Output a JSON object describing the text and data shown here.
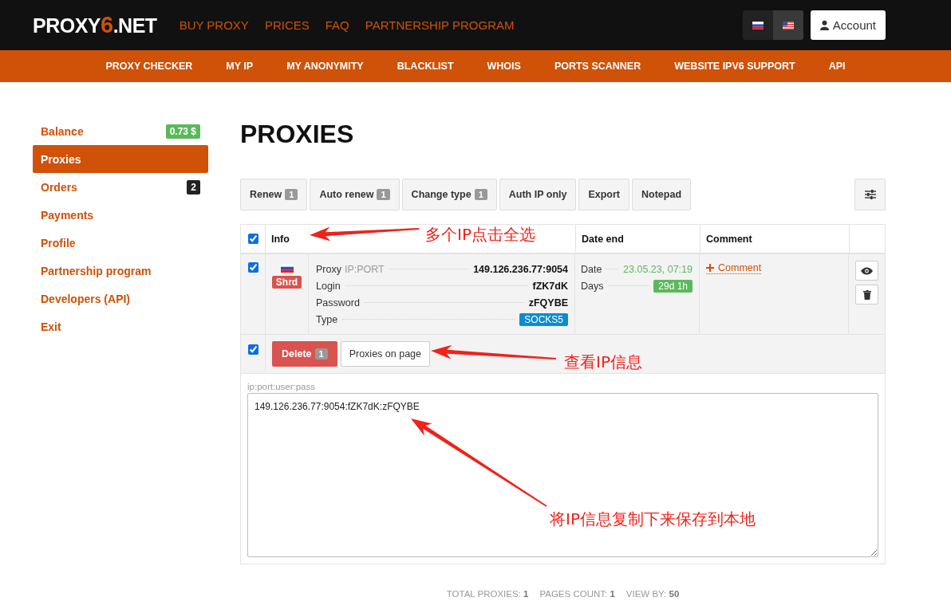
{
  "header": {
    "logo": {
      "main": "PROXY",
      "accent": "6",
      "tail": ".NET"
    },
    "menu": [
      "BUY PROXY",
      "PRICES",
      "FAQ",
      "PARTNERSHIP PROGRAM"
    ],
    "languages": [
      {
        "kind": "ru",
        "selected": false
      },
      {
        "kind": "us",
        "selected": true
      }
    ],
    "account": "Account"
  },
  "subnav": [
    "PROXY CHECKER",
    "MY IP",
    "MY ANONYMITY",
    "BLACKLIST",
    "WHOIS",
    "PORTS SCANNER",
    "WEBSITE IPV6 SUPPORT",
    "API"
  ],
  "sidebar": {
    "items": [
      {
        "label": "Balance",
        "selected": false,
        "badge": "0.73 $",
        "color": "#5cb85c"
      },
      {
        "label": "Proxies",
        "selected": true
      },
      {
        "label": "Orders",
        "selected": false,
        "badge": "2",
        "color": "#222222"
      },
      {
        "label": "Payments",
        "selected": false
      },
      {
        "label": "Profile",
        "selected": false
      },
      {
        "label": "Partnership program",
        "selected": false
      },
      {
        "label": "Developers (API)",
        "selected": false
      },
      {
        "label": "Exit",
        "selected": false
      }
    ]
  },
  "page_title": "PROXIES",
  "toolbar": [
    {
      "label": "Renew",
      "count": "1"
    },
    {
      "label": "Auto renew",
      "count": "1"
    },
    {
      "label": "Change type",
      "count": "1"
    },
    {
      "label": "Auth IP only"
    },
    {
      "label": "Export"
    },
    {
      "label": "Notepad"
    }
  ],
  "table": {
    "select_all": {
      "checked": true
    },
    "columns": [
      "Info",
      "Date end",
      "Comment"
    ],
    "rows": [
      {
        "checked": true,
        "kind": "ru",
        "tag": "Shrd",
        "info": [
          {
            "label": "Proxy",
            "hint": "IP:PORT",
            "kind": "text",
            "value": "149.126.236.77:9054"
          },
          {
            "label": "Login",
            "kind": "text",
            "value": "fZK7dK"
          },
          {
            "label": "Password",
            "kind": "text",
            "value": "zFQYBE"
          },
          {
            "label": "Type",
            "kind": "tag",
            "value": "SOCKS5",
            "color": "#0b8bd0"
          }
        ],
        "date_end": [
          {
            "label": "Date",
            "kind": "date",
            "value": "23.05.23, 07:19"
          },
          {
            "label": "Days",
            "kind": "tag",
            "value": "29d 1h",
            "color": "#5cb85c"
          }
        ],
        "comment_link": "Comment"
      }
    ]
  },
  "bulk": {
    "checked": true,
    "delete": {
      "label": "Delete",
      "count": "1"
    },
    "proxies_on_page": "Proxies on page"
  },
  "export": {
    "label": "ip:port:user:pass",
    "value": "149.126.236.77:9054:fZK7dK:zFQYBE"
  },
  "footer": [
    {
      "label": "TOTAL PROXIES:",
      "value": "1"
    },
    {
      "label": "PAGES COUNT:",
      "value": "1"
    },
    {
      "label": "VIEW BY:",
      "value": "50"
    }
  ],
  "annotations": [
    "多个IP点击全选",
    "查看IP信息",
    "将IP信息复制下来保存到本地"
  ]
}
